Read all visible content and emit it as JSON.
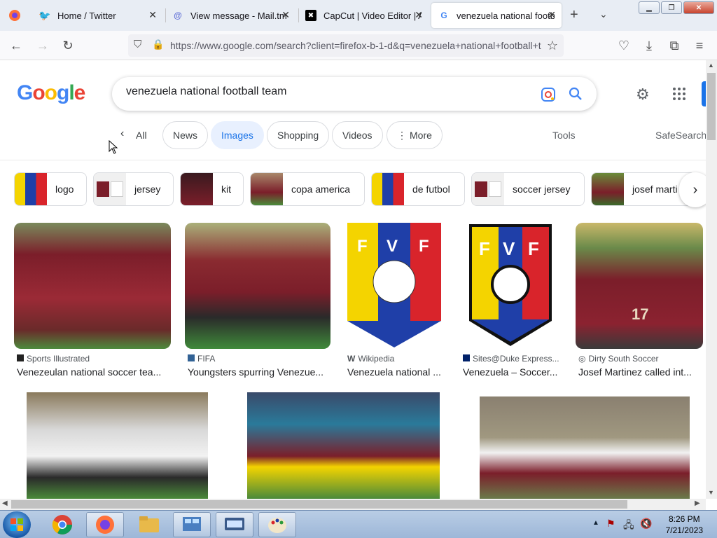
{
  "tabs": [
    {
      "label": "Home / Twitter",
      "icon": "twitter-icon"
    },
    {
      "label": "View message - Mail.tm",
      "icon": "mail-icon"
    },
    {
      "label": "CapCut | Video Editor | A",
      "icon": "capcut-icon"
    },
    {
      "label": "venezuela national footb",
      "icon": "google-icon"
    }
  ],
  "url": "https://www.google.com/search?client=firefox-b-1-d&q=venezuela+national+football+team",
  "search": {
    "query": "venezuela national football team"
  },
  "filters": {
    "all": "All",
    "news": "News",
    "images": "Images",
    "shopping": "Shopping",
    "videos": "Videos",
    "more": "More",
    "tools": "Tools",
    "safesearch": "SafeSearch"
  },
  "refinements": [
    "logo",
    "jersey",
    "kit",
    "copa america",
    "de futbol",
    "soccer jersey",
    "josef marti"
  ],
  "results": [
    {
      "source": "Sports Illustrated",
      "caption": "Venezeulan national soccer tea..."
    },
    {
      "source": "FIFA",
      "caption": "Youngsters spurring Venezue..."
    },
    {
      "source": "Wikipedia",
      "caption": "Venezuela national ..."
    },
    {
      "source": "Sites@Duke Express...",
      "caption": "Venezuela – Soccer..."
    },
    {
      "source": "Dirty South Soccer",
      "caption": "Josef Martinez called int..."
    }
  ],
  "logo_text": [
    "G",
    "o",
    "o",
    "g",
    "l",
    "e"
  ],
  "fvf": {
    "f1": "F",
    "v": "V",
    "f2": "F"
  },
  "jersey_number": "17",
  "clock": {
    "time": "8:26 PM",
    "date": "7/21/2023"
  },
  "colors": {
    "accent": "#1a73e8",
    "burgundy": "#7b1e2a"
  }
}
